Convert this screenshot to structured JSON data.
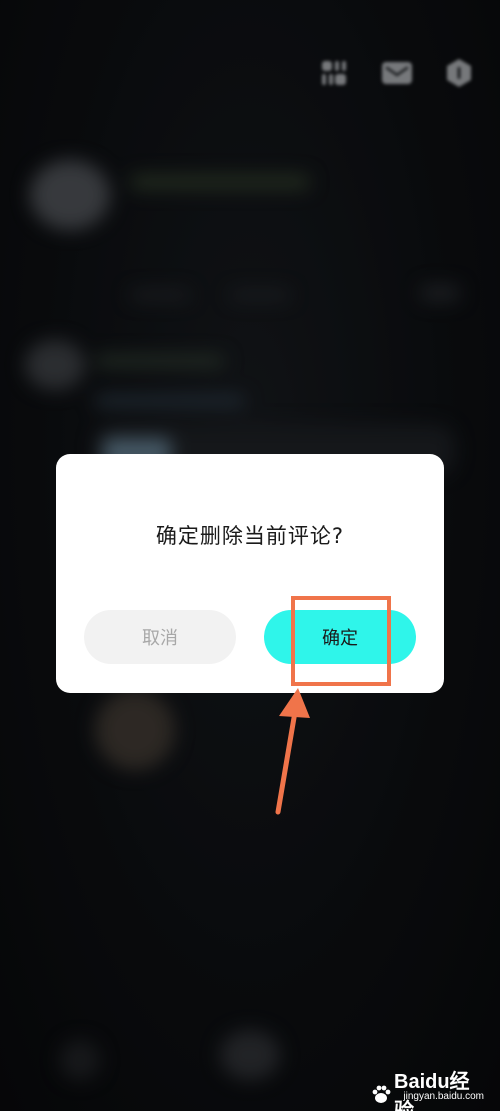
{
  "dialog": {
    "message": "确定删除当前评论?",
    "cancel_label": "取消",
    "confirm_label": "确定"
  },
  "background": {
    "partial_text": "..."
  },
  "icons": {
    "top_right": [
      "grid-apps-icon",
      "mail-icon",
      "hexagon-info-icon"
    ]
  },
  "colors": {
    "confirm_button": "#2ff5ea",
    "cancel_button": "#f2f2f2",
    "annotation": "#f0744a"
  },
  "watermark": {
    "logo_text": "Baidu经验",
    "url": "jingyan.baidu.com"
  }
}
